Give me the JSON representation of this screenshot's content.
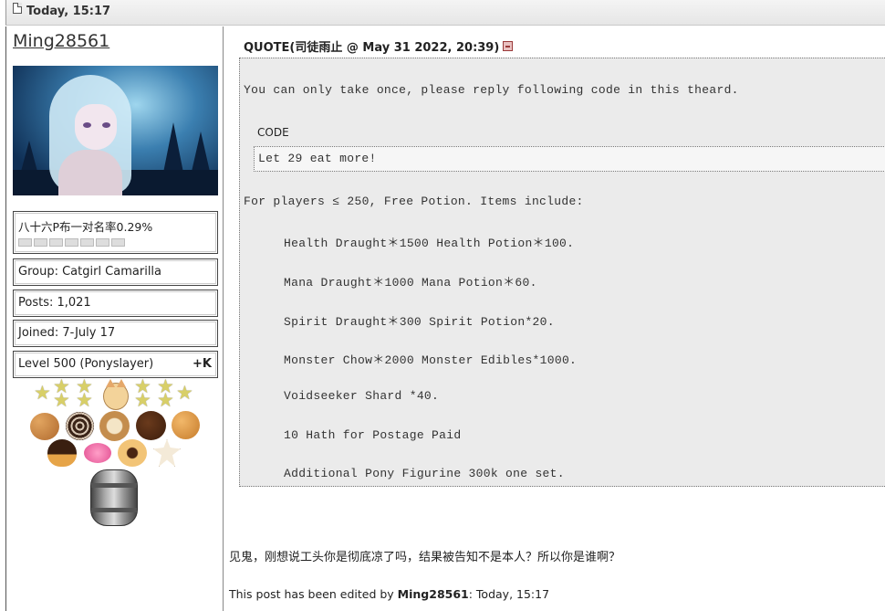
{
  "post_header": {
    "date": "Today, 15:17",
    "icon": "page-icon"
  },
  "author": {
    "username": "Ming28561",
    "ratio_text": "八十六P布一对名率0.29%",
    "group": "Group: Catgirl Camarilla",
    "posts": "Posts: 1,021",
    "joined": "Joined: 7-July 17",
    "level": "Level 500 (Ponyslayer)",
    "level_extra": "+K"
  },
  "quote": {
    "title": "QUOTE(司徒雨止 @ May 31 2022, 20:39)",
    "intro": "You can only take once, please reply following code in this theard.",
    "code_label": "CODE",
    "code_text": "Let 29 eat more!",
    "players_line": "For players ≤ 250, Free Potion. Items include:",
    "items": [
      "Health Draught＊1500 Health Potion＊100.",
      "Mana Draught＊1000 Mana Potion＊60.",
      "Spirit Draught＊300 Spirit Potion*20.",
      "Monster Chow＊2000 Monster Edibles*1000.",
      "Voidseeker Shard *40.",
      "10 Hath for Postage Paid",
      "Additional Pony Figurine 300k one set."
    ]
  },
  "body_text": "见鬼，刚想说工头你是彻底凉了吗，结果被告知不是本人？所以你是谁啊？",
  "edit_note": {
    "prefix": "This post has been edited by ",
    "user": "Ming28561",
    "suffix": ": Today, 15:17"
  }
}
